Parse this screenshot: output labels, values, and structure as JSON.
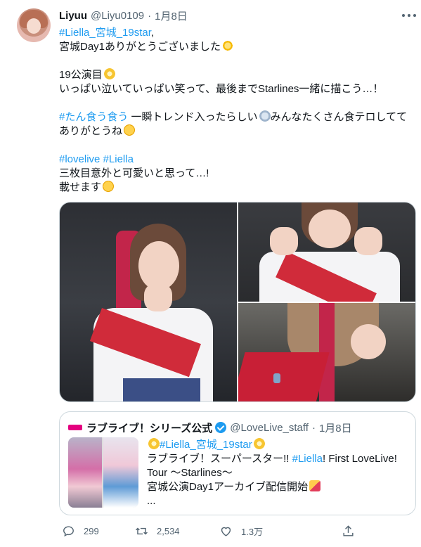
{
  "author": {
    "display_name": "Liyuu",
    "handle": "@Liyu0109",
    "separator": "·",
    "date": "1月8日"
  },
  "tweet": {
    "line1_tag": "#Liella_宮城_19star",
    "line1_suffix": ",",
    "line2": "宮城Day1ありがとうございました",
    "line3": "19公演目",
    "line4": "いっぱい泣いていっぱい笑って、最後までStarlines一緒に描こう…！",
    "line5_tag": "#たん食う食う",
    "line5_text": " 一瞬トレンド入ったらしい",
    "line5_after": "みんなたくさん食テロしてて",
    "line6": "ありがとうね",
    "line7_tag1": "#lovelive",
    "line7_tag2": "#Liella",
    "line8": "三枚目意外と可愛いと思って…!",
    "line9": "載せます"
  },
  "quote": {
    "display_name": "ラブライブ！シリーズ公式",
    "handle": "@LoveLive_staff",
    "separator": "·",
    "date": "1月8日",
    "line1_tag": "#Liella_宮城_19star",
    "line2_a": "ラブライブ！スーパースター!! ",
    "line2_tag": "#Liella",
    "line2_b": "! First LoveLive!",
    "line3": "Tour 〜Starlines〜",
    "line4": "宮城公演Day1アーカイブ配信開始",
    "line5": "..."
  },
  "actions": {
    "reply_count": "299",
    "retweet_count": "2,534",
    "like_count": "1.3万"
  },
  "colors": {
    "link": "#1d9bf0",
    "muted": "#536471",
    "border": "#cfd9de"
  },
  "icons": [
    "more-icon",
    "verified-icon",
    "reply-icon",
    "retweet-icon",
    "like-icon",
    "share-icon"
  ]
}
